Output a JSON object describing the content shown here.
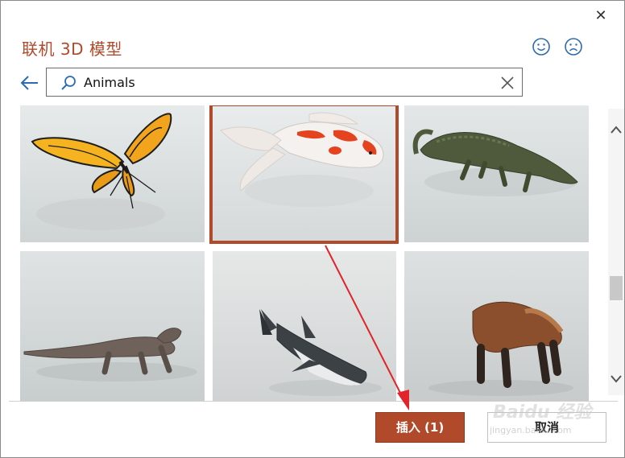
{
  "dialog": {
    "title": "联机 3D 模型",
    "close_glyph": "✕"
  },
  "search": {
    "value": "Animals",
    "placeholder": ""
  },
  "icons": {
    "back": "back-arrow-icon",
    "search": "search-icon",
    "clear": "close-icon",
    "happy": "smiley-face-icon",
    "sad": "frown-face-icon",
    "accent_color": "#b14a2b"
  },
  "results": [
    {
      "name": "butterfly",
      "selected": false
    },
    {
      "name": "koi-fish",
      "selected": true
    },
    {
      "name": "crocodile",
      "selected": false
    },
    {
      "name": "komodo-dragon",
      "selected": false
    },
    {
      "name": "shark",
      "selected": false
    },
    {
      "name": "wolverine",
      "selected": false
    }
  ],
  "footer": {
    "insert_label": "插入 (1)",
    "cancel_label": "取消"
  },
  "watermark": {
    "main": "Baidu 经验",
    "sub": "jingyan.baidu.com"
  }
}
